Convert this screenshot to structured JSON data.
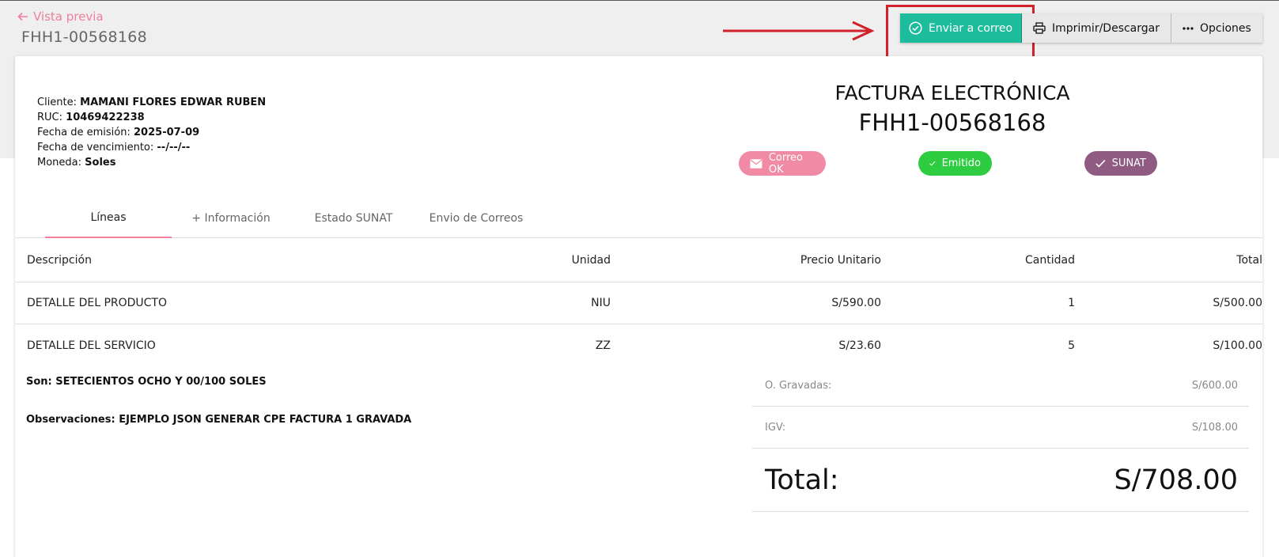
{
  "header": {
    "back_label": "Vista previa",
    "doc_id": "FHH1-00568168"
  },
  "actions": {
    "send_email": "Enviar a correo",
    "print_download": "Imprimir/Descargar",
    "options": "Opciones"
  },
  "client": {
    "cliente_label": "Cliente:",
    "cliente_value": "MAMANI FLORES EDWAR RUBEN",
    "ruc_label": "RUC:",
    "ruc_value": "10469422238",
    "emision_label": "Fecha de emisión:",
    "emision_value": "2025-07-09",
    "vencimiento_label": "Fecha de vencimiento:",
    "vencimiento_value": "--/--/--",
    "moneda_label": "Moneda:",
    "moneda_value": "Soles"
  },
  "invoice": {
    "type": "FACTURA ELECTRÓNICA",
    "number": "FHH1-00568168"
  },
  "badges": {
    "mail": "Correo OK",
    "emitido": "Emitido",
    "sunat": "SUNAT"
  },
  "tabs": [
    "Líneas",
    "+ Información",
    "Estado SUNAT",
    "Envio de Correos"
  ],
  "table": {
    "headers": [
      "Descripción",
      "Unidad",
      "Precio Unitario",
      "Cantidad",
      "Total"
    ],
    "rows": [
      [
        "DETALLE DEL PRODUCTO",
        "NIU",
        "S/590.00",
        "1",
        "S/500.00"
      ],
      [
        "DETALLE DEL SERVICIO",
        "ZZ",
        "S/23.60",
        "5",
        "S/100.00"
      ]
    ]
  },
  "notes": {
    "son": "Son: SETECIENTOS OCHO Y 00/100 SOLES",
    "observaciones": "Observaciones: EJEMPLO JSON GENERAR CPE FACTURA 1 GRAVADA"
  },
  "totals": {
    "gravadas_label": "O. Gravadas:",
    "gravadas_value": "S/600.00",
    "igv_label": "IGV:",
    "igv_value": "S/108.00",
    "total_label": "Total:",
    "total_value": "S/708.00"
  },
  "colors": {
    "accent_pink": "#ee7e9c",
    "primary_green": "#1dbc9c",
    "emitido_green": "#2ecc40",
    "sunat_purple": "#8f5b83",
    "annotation_red": "#d0202a"
  }
}
